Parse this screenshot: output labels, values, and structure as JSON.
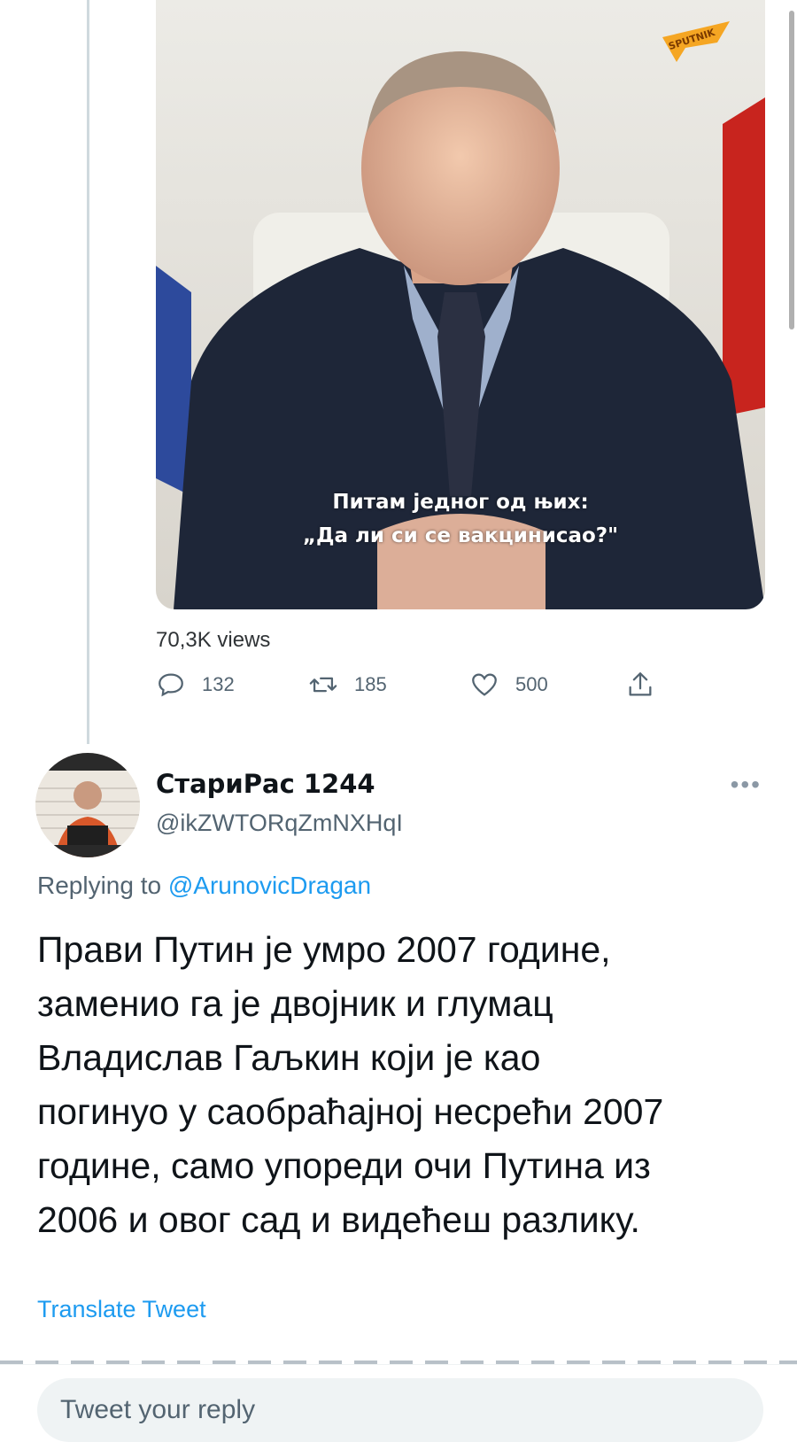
{
  "video": {
    "caption_line1": "Питам једног од њих:",
    "caption_line2": "„Да ли си се вакцинисао?\"",
    "watermark": "SPUTNIK"
  },
  "stats": {
    "views": "70,3K views",
    "replies": "132",
    "retweets": "185",
    "likes": "500"
  },
  "reply": {
    "author_name": "СтариРас 1244",
    "author_handle": "@ikZWTORqZmNXHqI",
    "replying_prefix": "Replying to",
    "replying_mention": "@ArunovicDragan",
    "lines": [
      "Прави Путин је умро 2007 године,",
      "заменио га је двојник и глумац",
      "Владислав Гаљкин који је као",
      "погинуо у саобраћајној несрећи 2007",
      "године, само упореди очи Путина из",
      "2006 и овог сад и видећеш разлику."
    ],
    "translate": "Translate Tweet",
    "more": "•••"
  },
  "composer": {
    "placeholder": "Tweet your reply"
  },
  "colors": {
    "accent": "#1d9bf0",
    "muted": "#536471"
  }
}
